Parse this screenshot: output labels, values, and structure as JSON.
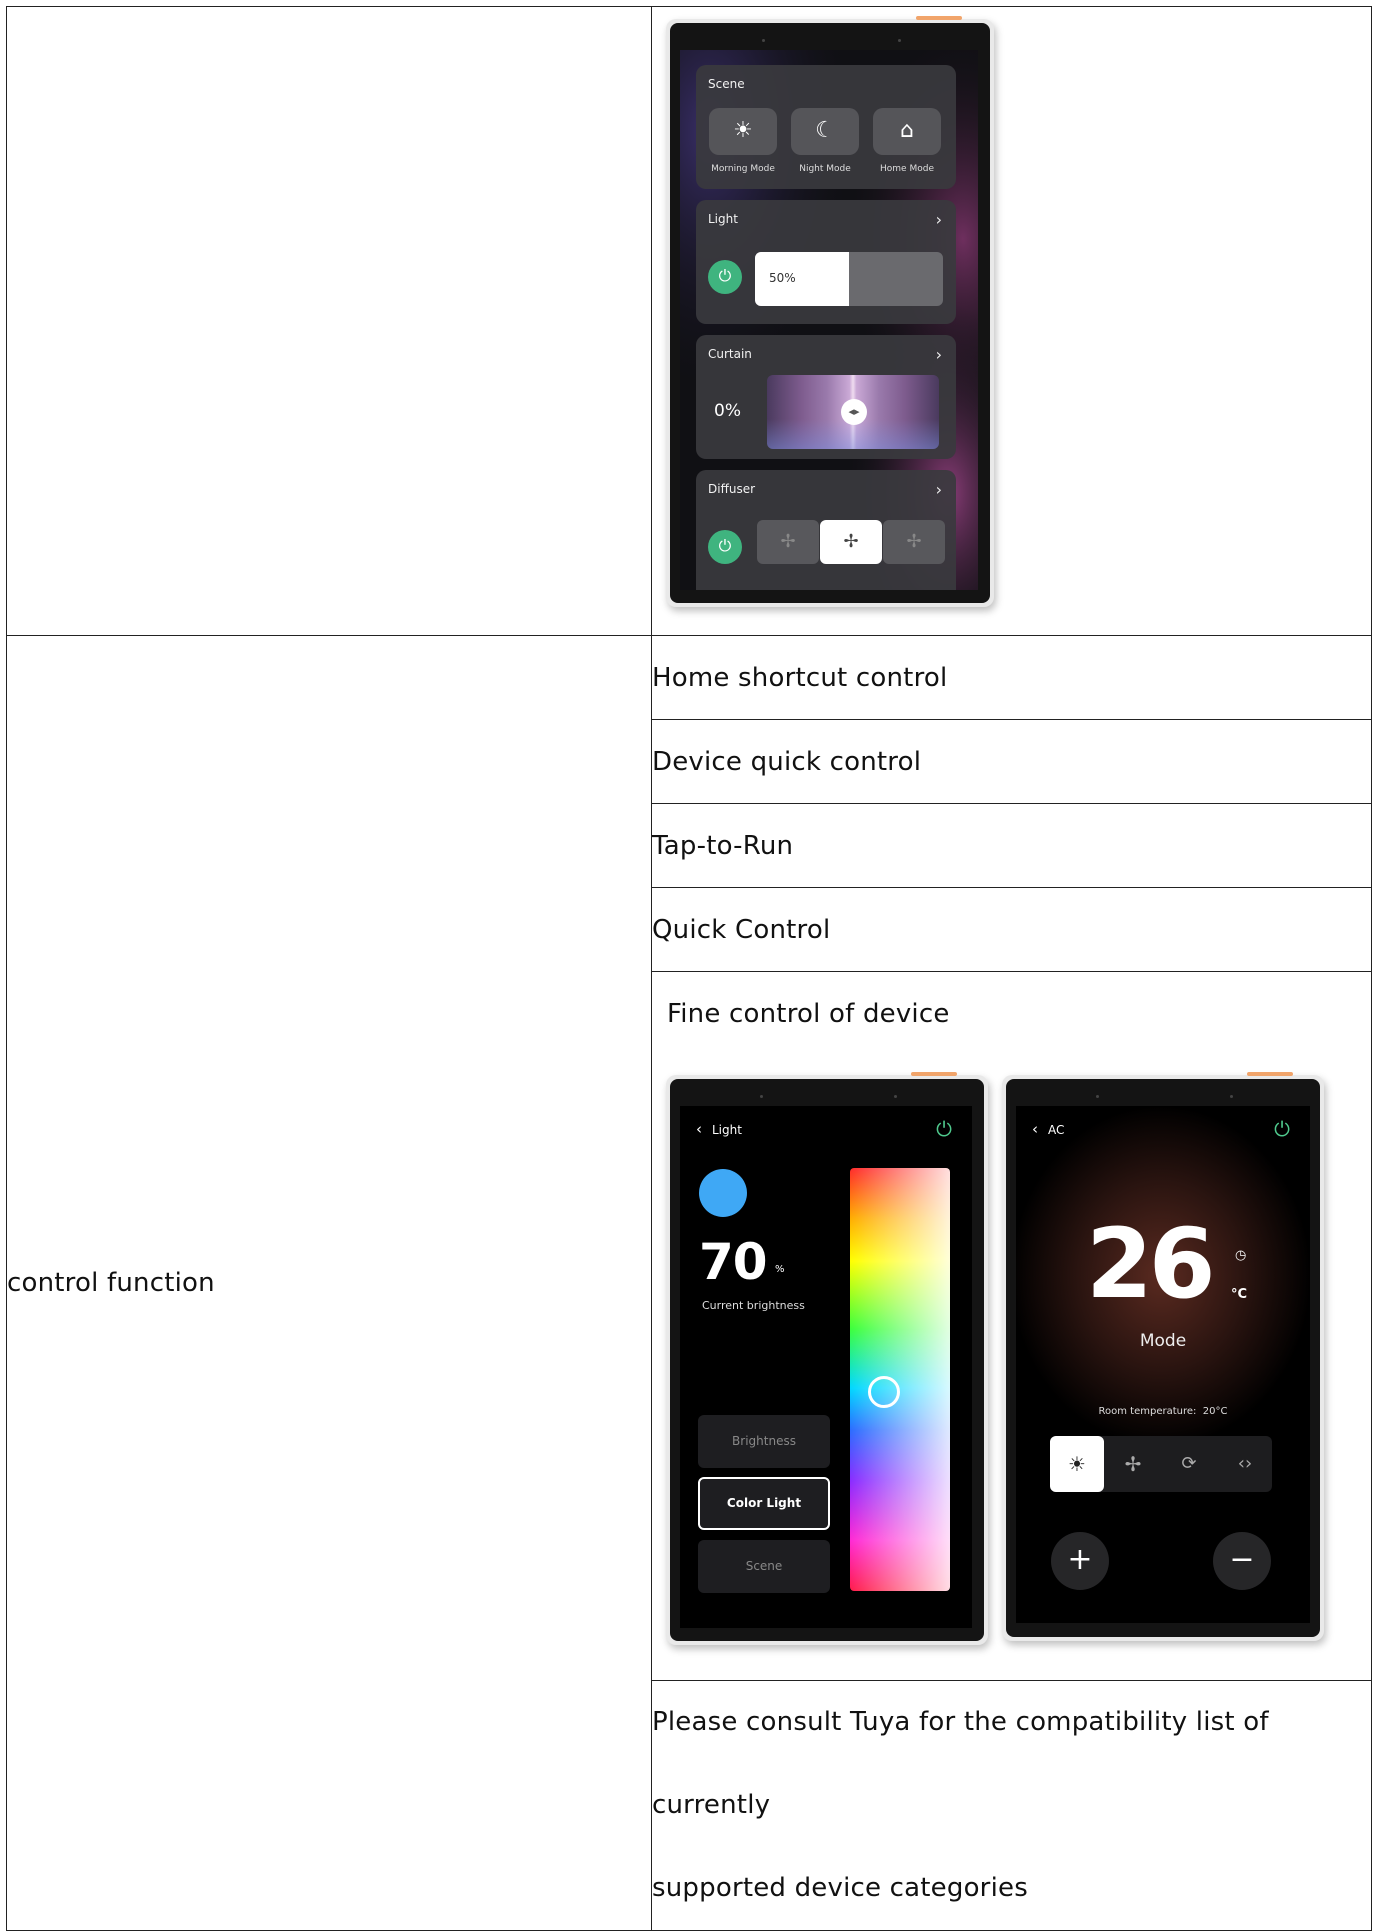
{
  "table": {
    "row2_label": "control function",
    "features": [
      "Home shortcut control",
      "Device quick control",
      "Tap-to-Run",
      "Quick Control"
    ],
    "fine_control": "Fine control of device",
    "compat_line1": "Please consult Tuya for the compatibility list of currently",
    "compat_line2": "supported device categories"
  },
  "home_screen": {
    "scene": {
      "title": "Scene",
      "buttons": [
        {
          "label": "Morning Mode",
          "icon": "sun-icon"
        },
        {
          "label": "Night Mode",
          "icon": "moon-icon"
        },
        {
          "label": "Home Mode",
          "icon": "home-user-icon"
        }
      ]
    },
    "light": {
      "title": "Light",
      "value": "50%",
      "level": 0.5
    },
    "curtain": {
      "title": "Curtain",
      "value": "0%"
    },
    "diffuser": {
      "title": "Diffuser"
    }
  },
  "light_screen": {
    "back_label": "Light",
    "brightness_value": "70",
    "brightness_unit": "%",
    "brightness_caption": "Current brightness",
    "swatch_color": "#3fa8f5",
    "buttons": [
      "Brightness",
      "Color Light",
      "Scene"
    ],
    "selected_button": "Color Light"
  },
  "ac_screen": {
    "back_label": "AC",
    "temperature": "26",
    "unit": "°C",
    "mode_label": "Mode",
    "room_temp": "Room temperature:  20°C",
    "modes": [
      "sun-icon",
      "fan-icon",
      "dry-icon",
      "auto-icon"
    ],
    "plus": "+",
    "minus": "−"
  },
  "colors": {
    "accent_green": "#3fb47f",
    "power_green": "#4fc98d",
    "device_tab": "#f1a46a"
  }
}
